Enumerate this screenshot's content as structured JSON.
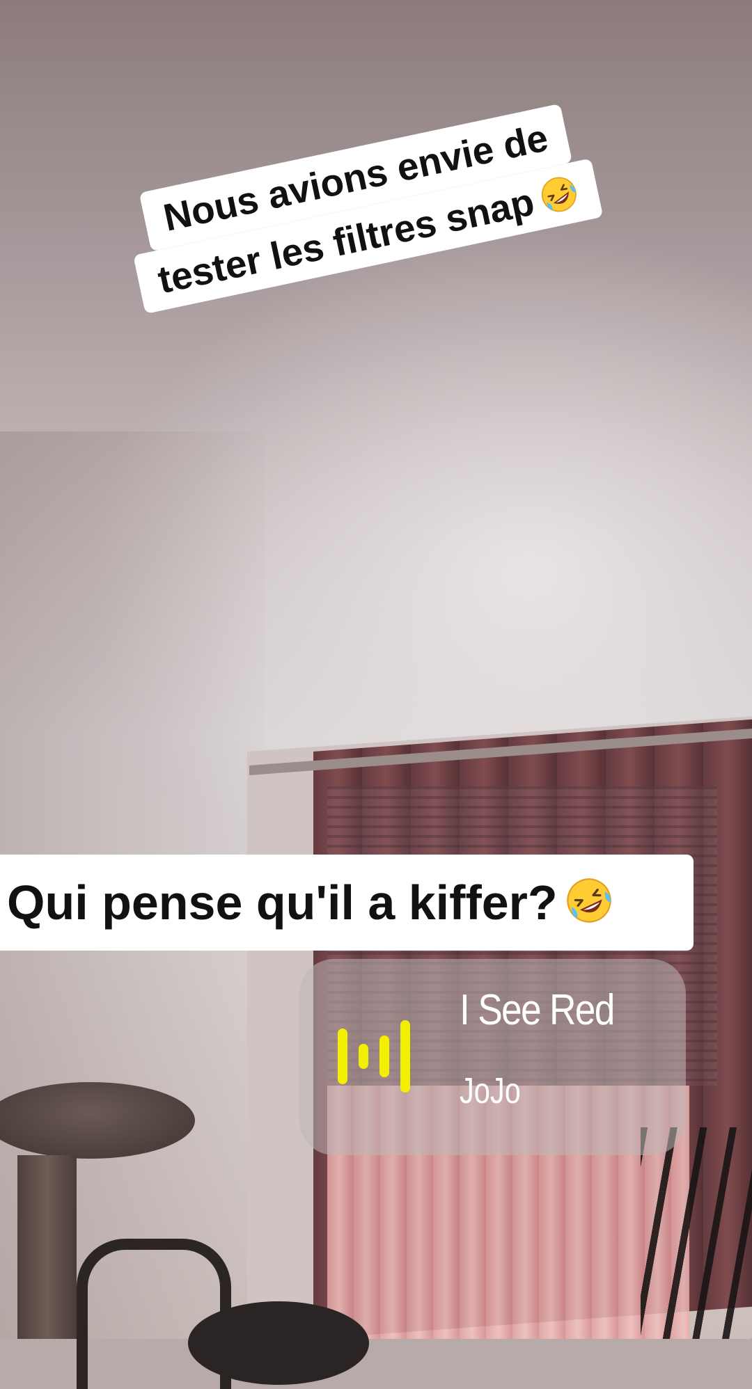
{
  "captions": {
    "top_line1": "Nous avions envie de",
    "top_line2": "tester les filtres snap",
    "middle": "Qui pense qu'il a kiffer?"
  },
  "music": {
    "title": "I See Red",
    "artist": "JoJo",
    "icon": "audio-bars-icon"
  },
  "colors": {
    "sticker_bg": "#ffffff",
    "sticker_text": "#111111",
    "music_accent": "#f2ef00"
  }
}
